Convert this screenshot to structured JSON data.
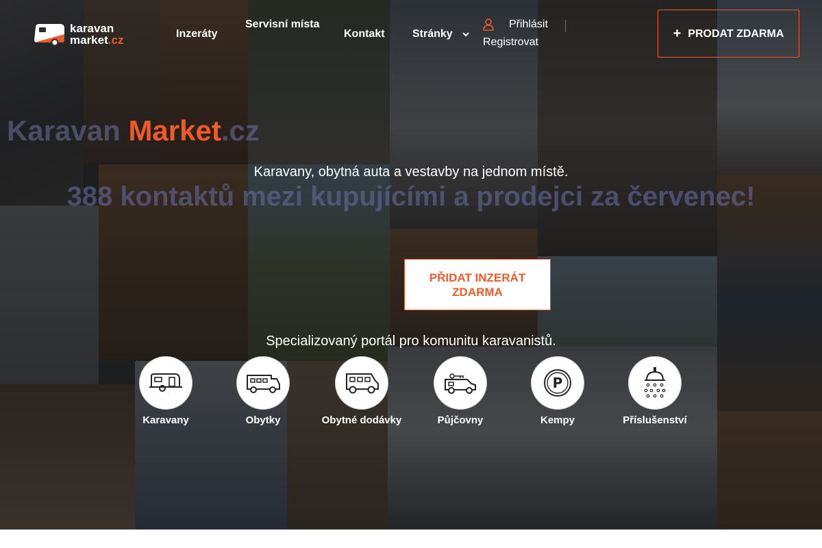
{
  "header": {
    "logo": {
      "line1": "karavan",
      "line2_main": "market",
      "line2_accent": ".cz"
    },
    "nav": [
      {
        "label": "Inzeráty"
      },
      {
        "label": "Servisní místa"
      },
      {
        "label": "Kontakt"
      },
      {
        "label": "Stránky"
      }
    ],
    "auth": {
      "login": "Přihlásit",
      "register": "Registrovat"
    },
    "sell_button": {
      "label": "PRODAT ZDARMA"
    }
  },
  "hero": {
    "title_part1": "Karavan ",
    "title_part2": "Market",
    "title_part3": ".cz",
    "subtitle": "Karavany, obytná auta a vestavby na jednom místě.",
    "headline": "388 kontaktů mezi kupujícími a prodejci za červenec!",
    "cta_label": "PŘIDAT INZERÁT ZDARMA",
    "tagline": "Specializovaný portál pro komunitu karavanistů."
  },
  "categories": [
    {
      "label": "Karavany",
      "icon": "caravan-icon"
    },
    {
      "label": "Obytky",
      "icon": "motorhome-icon"
    },
    {
      "label": "Obytné dodávky",
      "icon": "camper-van-icon"
    },
    {
      "label": "Půjčovny",
      "icon": "rental-van-icon"
    },
    {
      "label": "Kempy",
      "icon": "parking-icon"
    },
    {
      "label": "Příslušenství",
      "icon": "shower-icon"
    }
  ],
  "colors": {
    "accent": "#f05a28",
    "text_light": "#ffffff"
  }
}
